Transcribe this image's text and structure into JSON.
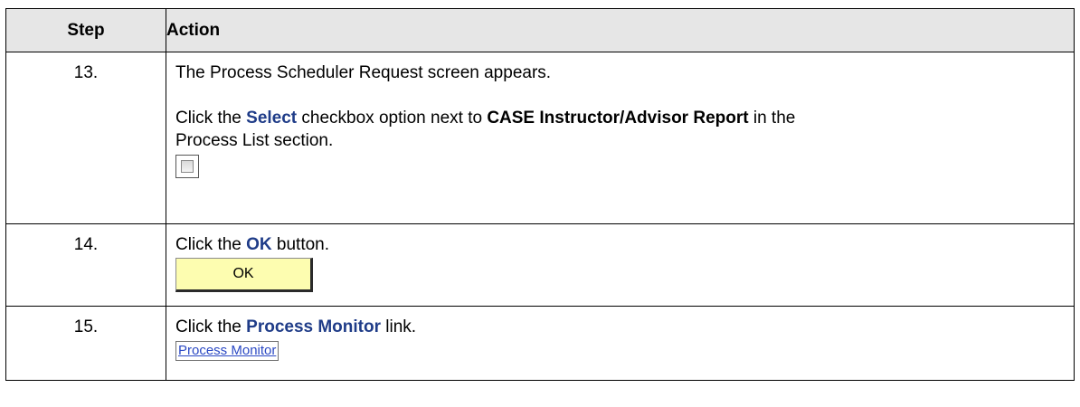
{
  "table": {
    "header": {
      "step": "Step",
      "action": "Action"
    },
    "rows": [
      {
        "step": "13.",
        "line1": "The Process Scheduler Request screen appears.",
        "line2_pre": "Click the ",
        "line2_kw": "Select",
        "line2_mid": " checkbox option next to ",
        "line2_bold": "CASE Instructor/Advisor Report",
        "line2_post": " in the",
        "line3": "Process List section.",
        "widget": {
          "type": "checkbox",
          "checked": false,
          "icon": "checkbox-icon"
        }
      },
      {
        "step": "14.",
        "line1_pre": "Click the ",
        "line1_kw": "OK",
        "line1_post": " button.",
        "widget": {
          "type": "button",
          "label": "OK",
          "bg_color": "#fdfdb0"
        }
      },
      {
        "step": "15.",
        "line1_pre": "Click the ",
        "line1_kw": "Process Monitor",
        "line1_post": " link.",
        "widget": {
          "type": "link",
          "label": "Process Monitor",
          "color": "#2b49c4"
        }
      }
    ]
  },
  "colors": {
    "header_bg": "#e6e6e6",
    "keyword": "#1f3c88"
  }
}
